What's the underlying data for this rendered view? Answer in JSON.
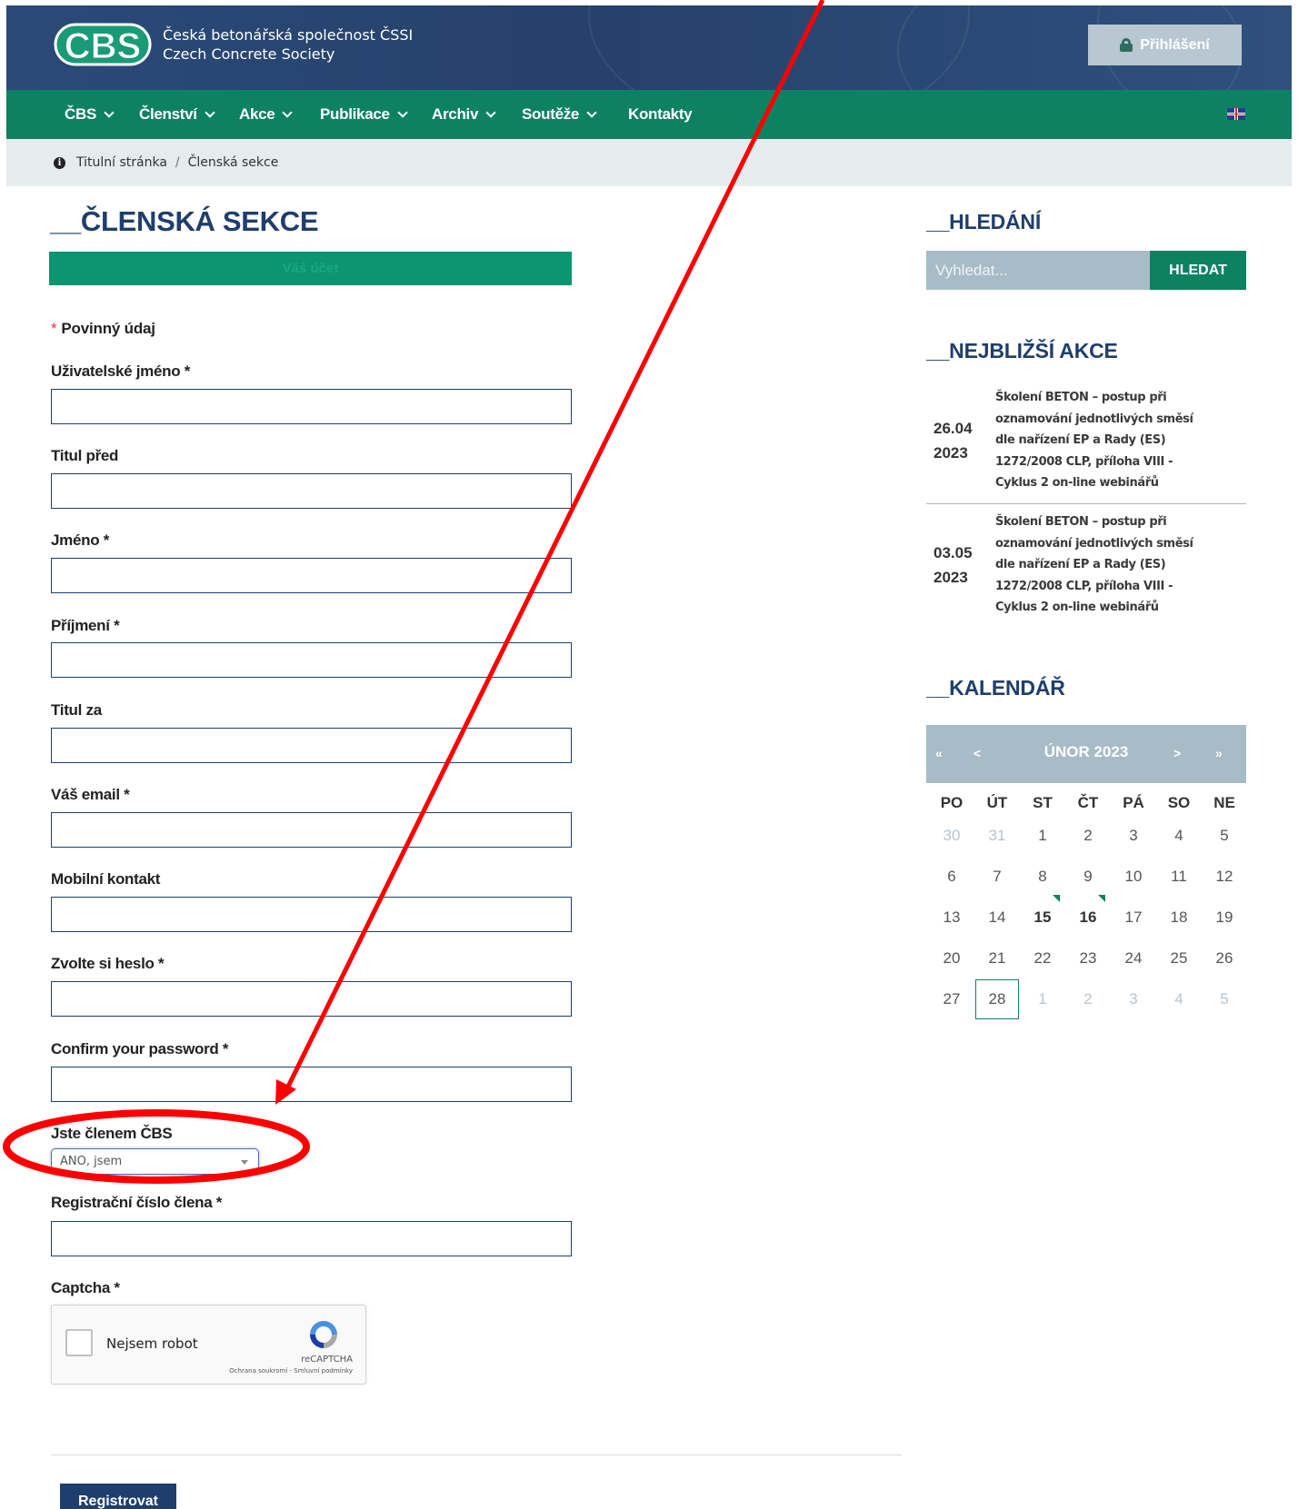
{
  "header": {
    "org_line1": "Česká betonářská společnost ČSSI",
    "org_line2": "Czech Concrete Society",
    "logo_text": "CBS",
    "login_label": "Přihlášení"
  },
  "nav": {
    "items": [
      {
        "label": "ČBS",
        "dropdown": true
      },
      {
        "label": "Členství",
        "dropdown": true
      },
      {
        "label": "Akce",
        "dropdown": true
      },
      {
        "label": "Publikace",
        "dropdown": true
      },
      {
        "label": "Archiv",
        "dropdown": true
      },
      {
        "label": "Soutěže",
        "dropdown": true
      },
      {
        "label": "Kontakty",
        "dropdown": false
      }
    ],
    "language_flag": "uk-flag-icon"
  },
  "breadcrumb": {
    "home": "Titulní stránka",
    "separator": "/",
    "current": "Členská sekce"
  },
  "main": {
    "title": "__ČLENSKÁ SEKCE",
    "tab_label": "Váš účet",
    "required_star": "*",
    "required_note": "Povinný údaj",
    "fields": [
      {
        "label": "Uživatelské jméno *",
        "value": ""
      },
      {
        "label": "Titul před",
        "value": ""
      },
      {
        "label": "Jméno *",
        "value": ""
      },
      {
        "label": "Příjmení *",
        "value": ""
      },
      {
        "label": "Titul za",
        "value": ""
      },
      {
        "label": "Váš email *",
        "value": ""
      },
      {
        "label": "Mobilní kontakt",
        "value": ""
      },
      {
        "label": "Zvolte si heslo *",
        "value": ""
      },
      {
        "label": "Confirm your password *",
        "value": ""
      }
    ],
    "member_label": "Jste členem ČBS",
    "member_select": "ANO, jsem",
    "reg_number_label": "Registrační číslo člena *",
    "captcha_label": "Captcha *",
    "recaptcha": {
      "checkbox_label": "Nejsem robot",
      "brand": "reCAPTCHA",
      "links": "Ochrana soukromí - Smluvní podmínky"
    },
    "submit_label": "Registrovat"
  },
  "sidebar": {
    "search_title": "__HLEDÁNÍ",
    "search_placeholder": "Vyhledat...",
    "search_button": "HLEDAT",
    "events_title": "__NEJBLIŽŠÍ AKCE",
    "events": [
      {
        "day": "26.04",
        "year": "2023",
        "title_lines": [
          "Školení BETON – postup při",
          "oznamování jednotlivých směsí",
          "dle nařízení EP a Rady (ES)",
          "1272/2008 CLP, příloha VIII -",
          "Cyklus 2 on-line webinářů"
        ]
      },
      {
        "day": "03.05",
        "year": "2023",
        "title_lines": [
          "Školení BETON – postup při",
          "oznamování jednotlivých směsí",
          "dle nařízení EP a Rady (ES)",
          "1272/2008 CLP, příloha VIII -",
          "Cyklus 2 on-line webinářů"
        ]
      }
    ],
    "calendar_title": "__KALENDÁŘ",
    "calendar": {
      "month_label": "ÚNOR 2023",
      "nav_prev_year": "«",
      "nav_prev": "<",
      "nav_next": ">",
      "nav_next_year": "»",
      "weekdays": [
        "PO",
        "ÚT",
        "ST",
        "ČT",
        "PÁ",
        "SO",
        "NE"
      ],
      "weeks": [
        [
          {
            "d": "30",
            "m": true
          },
          {
            "d": "31",
            "m": true
          },
          {
            "d": "1"
          },
          {
            "d": "2"
          },
          {
            "d": "3"
          },
          {
            "d": "4"
          },
          {
            "d": "5"
          }
        ],
        [
          {
            "d": "6"
          },
          {
            "d": "7"
          },
          {
            "d": "8"
          },
          {
            "d": "9"
          },
          {
            "d": "10"
          },
          {
            "d": "11"
          },
          {
            "d": "12"
          }
        ],
        [
          {
            "d": "13"
          },
          {
            "d": "14"
          },
          {
            "d": "15",
            "e": true
          },
          {
            "d": "16",
            "e": true
          },
          {
            "d": "17"
          },
          {
            "d": "18"
          },
          {
            "d": "19"
          }
        ],
        [
          {
            "d": "20"
          },
          {
            "d": "21"
          },
          {
            "d": "22"
          },
          {
            "d": "23"
          },
          {
            "d": "24"
          },
          {
            "d": "25"
          },
          {
            "d": "26"
          }
        ],
        [
          {
            "d": "27"
          },
          {
            "d": "28",
            "t": true
          },
          {
            "d": "1",
            "m": true
          },
          {
            "d": "2",
            "m": true
          },
          {
            "d": "3",
            "m": true
          },
          {
            "d": "4",
            "m": true
          },
          {
            "d": "5",
            "m": true
          }
        ]
      ]
    }
  },
  "colors": {
    "header_blue": "#26416b",
    "nav_green": "#0d8262",
    "title_blue": "#1e3e6d",
    "annotation_red": "#ff0000"
  }
}
